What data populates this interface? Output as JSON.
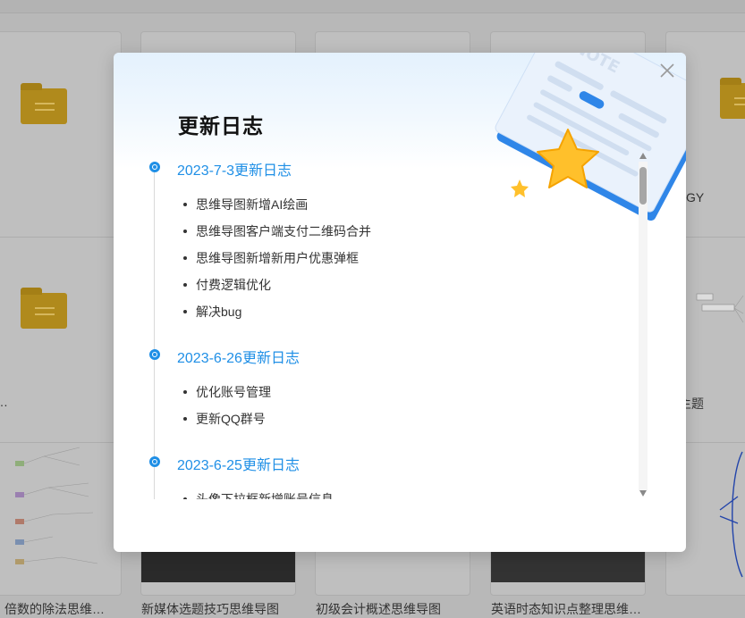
{
  "modal": {
    "title": "更新日志",
    "close_label": "×",
    "entries": [
      {
        "title": "2023-7-3更新日志",
        "items": [
          "思维导图新增AI绘画",
          "思维导图客户端支付二维码合并",
          "思维导图新增新用户优惠弹框",
          "付费逻辑优化",
          "解决bug"
        ]
      },
      {
        "title": "2023-6-26更新日志",
        "items": [
          "优化账号管理",
          "更新QQ群号"
        ]
      },
      {
        "title": "2023-6-25更新日志",
        "items": [
          "头像下拉框新增账号信息"
        ]
      }
    ],
    "illustration_text": "NOTE"
  },
  "background": {
    "card_fragment_right_1": "GY",
    "card_fragment_left_2": "…",
    "card_fragment_right_2": "主题",
    "bottom_labels": [
      "倍数的除法思维…",
      "新媒体选题技巧思维导图",
      "初级会计概述思维导图",
      "英语时态知识点整理思维…"
    ]
  },
  "colors": {
    "accent": "#1f8fe6",
    "folder": "#b08a1c"
  }
}
